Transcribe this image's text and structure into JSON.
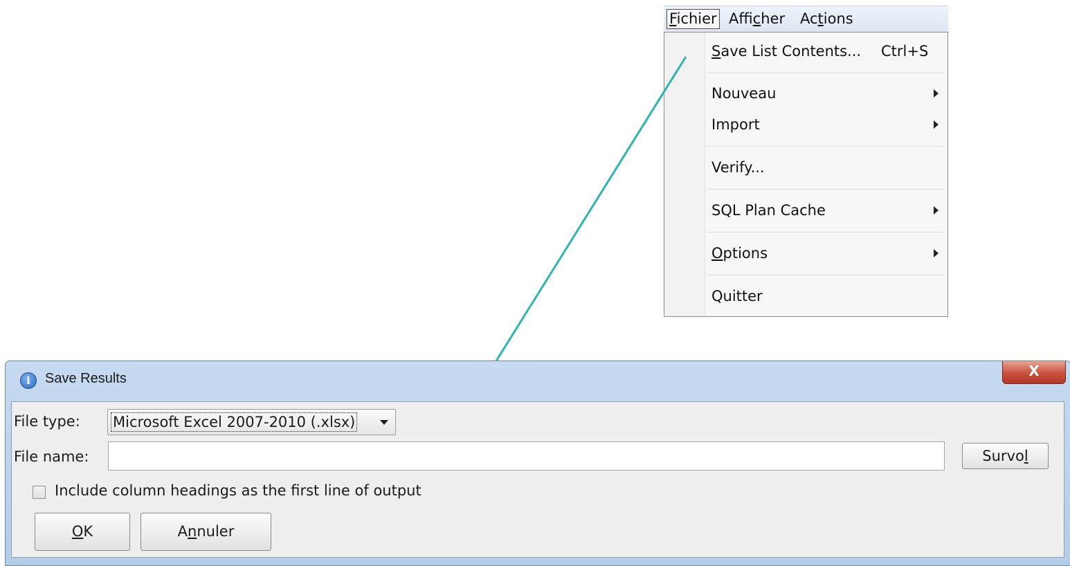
{
  "menu": {
    "bar": [
      {
        "label": "Fichier",
        "active": true
      },
      {
        "label": "Afficher",
        "active": false
      },
      {
        "label": "Actions",
        "active": false
      }
    ],
    "items": {
      "save_list": {
        "label": "Save List Contents...",
        "shortcut": "Ctrl+S"
      },
      "nouveau": {
        "label": "Nouveau",
        "submenu": true
      },
      "import": {
        "label": "Import",
        "submenu": true
      },
      "verify": {
        "label": "Verify..."
      },
      "sql_plan_cache": {
        "label": "SQL Plan Cache",
        "submenu": true
      },
      "options": {
        "label": "Options",
        "submenu": true
      },
      "quitter": {
        "label": "Quitter"
      }
    }
  },
  "connector": {
    "color": "#2eb5ad",
    "from": "save-list-contents",
    "to": "save-results-dialog"
  },
  "dialog": {
    "title": "Save Results",
    "title_icon": "info-icon",
    "close_glyph": "X",
    "file_type_label": "File type:",
    "file_type_value": "Microsoft Excel 2007-2010 (.xlsx)",
    "file_name_label": "File name:",
    "file_name_value": "",
    "browse_label": "Survol",
    "include_headings_label": "Include column headings as the first line of output",
    "include_headings_checked": false,
    "ok_label": "OK",
    "cancel_label": "Annuler"
  }
}
